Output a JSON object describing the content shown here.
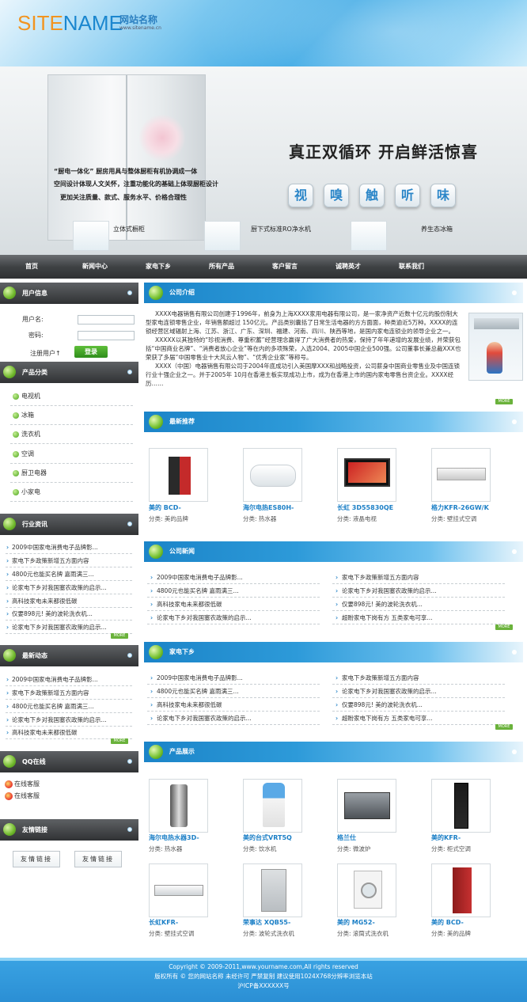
{
  "header": {
    "logo_en_site": "SITE",
    "logo_en_name": "NAME",
    "logo_cn": "网站名称",
    "logo_url": "www.sitename.cn"
  },
  "banner": {
    "feature1": "“厨电一体化” 厨房用具与整体厨柜有机协调成一体",
    "feature2": "空间设计体现人文关怀，注重功能化的基础上体现厨柜设计",
    "feature3": "更加关注质量、款式、服务水平、价格合理性",
    "slogan": "真正双循环 开启鲜活惊喜",
    "senses": [
      "视",
      "嗅",
      "触",
      "听",
      "味"
    ],
    "products": [
      "立体式橱柜",
      "厨下式标准RO净水机",
      "养生态冰箱"
    ]
  },
  "nav": [
    "首页",
    "新闻中心",
    "家电下乡",
    "所有产品",
    "客户留言",
    "诚聘英才",
    "联系我们"
  ],
  "sidebar": {
    "user_title": "用户信息",
    "username_label": "用户名:",
    "password_label": "密码:",
    "register": "注册用户↑",
    "login_button": "登录",
    "category_title": "产品分类",
    "categories": [
      "电视机",
      "冰箱",
      "洗衣机",
      "空调",
      "厨卫电器",
      "小家电"
    ],
    "industry_title": "行业资讯",
    "industry": [
      "2009中国家电消费电子品牌影...",
      "家电下乡政策新增五方面内容",
      "4800元也能买名牌 嘉雨满三...",
      "论家电下乡对我国塞农政策的启示...",
      "高科技家电未来都很低碳",
      "仅要898元! 美的波轮洗衣机...",
      "论家电下乡对我国塞农政策的启示..."
    ],
    "latest_title": "最新动态",
    "latest": [
      "2009中国家电消费电子品牌影...",
      "家电下乡政策新增五方面内容",
      "4800元也能买名牌 嘉雨满三...",
      "论家电下乡对我国塞农政策的启示...",
      "高科技家电未来都很低碳"
    ],
    "more": "MORE",
    "qq_title": "QQ在线",
    "qq": [
      "在线客服",
      "在线客服"
    ],
    "links_title": "友情链接",
    "links": [
      "友情链接",
      "友情链接"
    ]
  },
  "about": {
    "title": "公司介绍",
    "p1": "XXXX电器销售有限公司创建于1996年，前身为上海XXXX家用电器有限公司，是一家净资产近数十亿元的股份制大型家电连锁零售企业，年销售额超过 150亿元。产品类别囊括了日常生活电器的方方面面，种类逾近5万种。XXXX的连锁经营区域辐射上海、江苏、浙江、广东、深圳、福建、河南、四川、陕西等地，是国内家电连锁业的领导企业之一。",
    "p2": "XXXXX以其独特的“珍视消费、尊重积蓄”经营理念赢得了广大消费者的热爱，保持了年年递增的发展业绩，并荣获包括“中国商业名牌”、“消费者放心企业”等在内的多项殊荣，入选2004、2005中国企业500强。公司董事长兼总裁XXX也荣获了多届“中国零售业十大风云人物”、“优秀企业家”等称号。",
    "p3": "XXXX（中国）电器销售有限公司于2004年底成功引入美国摩XXX和战略投资，公司薪身中国商业零售业及中国连锁行业十强企业之一。并于2005年 10月在香港主板实现成功上市，成为在香港上市的国内家电零售台资企业。XXXX经历……"
  },
  "recommend": {
    "title": "最新推荐",
    "items": [
      {
        "name": "美的 BCD-",
        "cat": "分类: 美的品牌"
      },
      {
        "name": "海尔电热ES80H-",
        "cat": "分类: 热水器"
      },
      {
        "name": "长虹 3D55830QE",
        "cat": "分类: 液晶电视"
      },
      {
        "name": "格力KFR-26GW/K",
        "cat": "分类: 壁挂式空调"
      }
    ]
  },
  "company_news": {
    "title": "公司新闻",
    "left": [
      "2009中国家电消费电子品牌影...",
      "4800元也能买名牌 嘉雨满三...",
      "高科技家电未来都很低碳",
      "论家电下乡对我国塞农政策的启示..."
    ],
    "right": [
      "家电下乡政策新增五方面内容",
      "论家电下乡对我国塞农政策的启示...",
      "仅要898元! 美的波轮洗衣机...",
      "超盼家电下岗有方 五类家电可享..."
    ]
  },
  "countryside": {
    "title": "家电下乡",
    "left": [
      "2009中国家电消费电子品牌影...",
      "4800元也能买名牌 嘉雨满三...",
      "高科技家电未来都很低碳",
      "论家电下乡对我国塞农政策的启示..."
    ],
    "right": [
      "家电下乡政策新增五方面内容",
      "论家电下乡对我国塞农政策的启示...",
      "仅要898元! 美的波轮洗衣机...",
      "超盼家电下岗有方 五类家电可享..."
    ]
  },
  "showcase": {
    "title": "产品展示",
    "items": [
      {
        "name": "海尔电热水器3D-",
        "cat": "分类: 热水器"
      },
      {
        "name": "美的台式VRT5Q",
        "cat": "分类: 饮水机"
      },
      {
        "name": "格兰仕",
        "cat": "分类: 微波炉"
      },
      {
        "name": "美的KFR-",
        "cat": "分类: 柜式空调"
      },
      {
        "name": "长虹KFR-",
        "cat": "分类: 壁挂式空调"
      },
      {
        "name": "荣事达 XQB55-",
        "cat": "分类: 波轮式洗衣机"
      },
      {
        "name": "美的 MG52-",
        "cat": "分类: 滚筒式洗衣机"
      },
      {
        "name": "美的 BCD-",
        "cat": "分类: 美的品牌"
      }
    ]
  },
  "footer": {
    "line1": "Copyright © 2009-2011,www.yourname.com,All rights reserved",
    "line2": "版权所有 © 您的网站名称 未经许可 严禁复制 建议使用1024X768分辨率浏览本站",
    "line3": "沪ICP备XXXXXX号"
  },
  "colors": {
    "accent": "#2b8fd4",
    "nav": "#3f4244",
    "green": "#6ab23b"
  }
}
